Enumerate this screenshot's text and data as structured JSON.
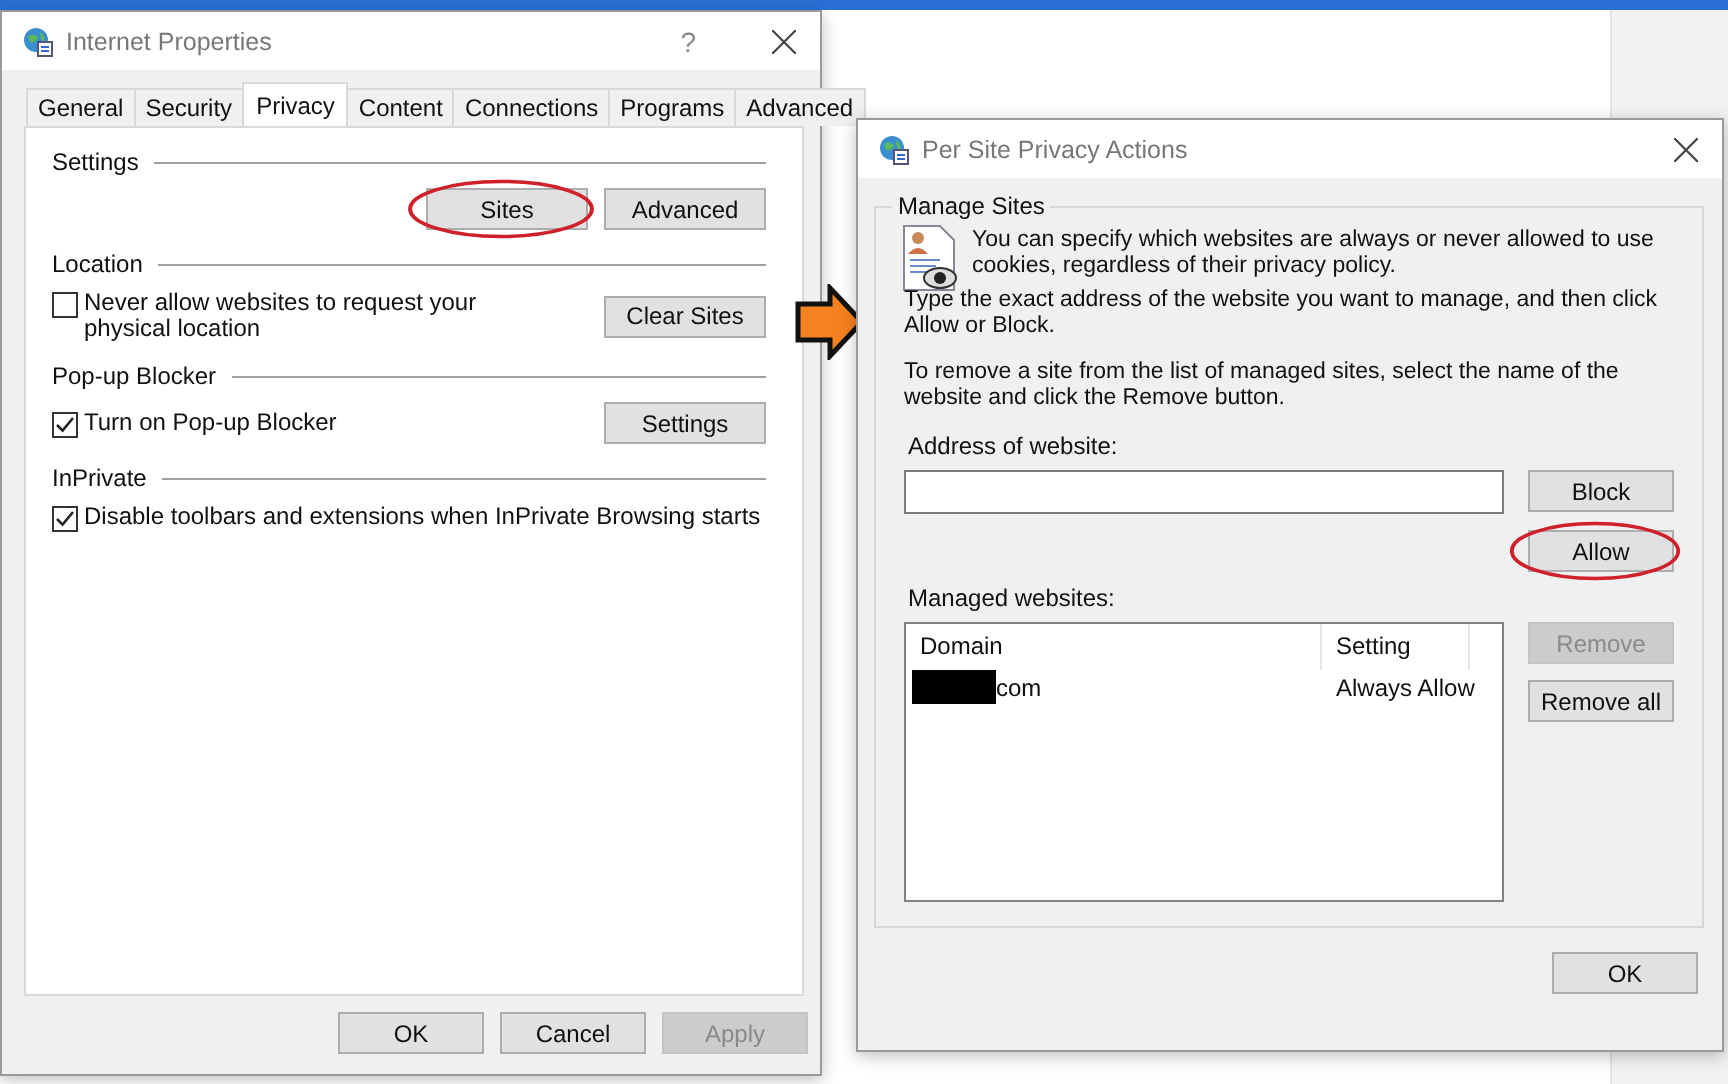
{
  "internet_properties": {
    "title": "Internet Properties",
    "help": "?",
    "tabs": [
      {
        "label": "General",
        "selected": false
      },
      {
        "label": "Security",
        "selected": false
      },
      {
        "label": "Privacy",
        "selected": true
      },
      {
        "label": "Content",
        "selected": false
      },
      {
        "label": "Connections",
        "selected": false
      },
      {
        "label": "Programs",
        "selected": false
      },
      {
        "label": "Advanced",
        "selected": false
      }
    ],
    "sections": [
      {
        "title": "Settings",
        "buttons": [
          {
            "label": "Sites",
            "highlighted": true
          },
          {
            "label": "Advanced",
            "highlighted": false
          }
        ]
      },
      {
        "title": "Location",
        "checkbox": {
          "label": "Never allow websites to request your physical location",
          "checked": false
        },
        "buttons": [
          {
            "label": "Clear Sites",
            "highlighted": false
          }
        ]
      },
      {
        "title": "Pop-up Blocker",
        "checkbox": {
          "label": "Turn on Pop-up Blocker",
          "checked": true
        },
        "buttons": [
          {
            "label": "Settings",
            "highlighted": false
          }
        ]
      },
      {
        "title": "InPrivate",
        "checkbox": {
          "label": "Disable toolbars and extensions when InPrivate Browsing starts",
          "checked": true
        }
      }
    ],
    "buttons": [
      {
        "label": "OK",
        "disabled": false
      },
      {
        "label": "Cancel",
        "disabled": false
      },
      {
        "label": "Apply",
        "disabled": true
      }
    ]
  },
  "per_site": {
    "title": "Per Site Privacy Actions",
    "group_title": "Manage Sites",
    "intro": "You can specify which websites are always or never allowed to use cookies, regardless of their privacy policy.",
    "instructions": [
      "Type the exact address of the website you want to manage, and then click Allow or Block.",
      "To remove a site from the list of managed sites, select the name of the website and click the Remove button."
    ],
    "address_label": "Address of website:",
    "action_buttons": [
      {
        "label": "Block",
        "highlighted": false
      },
      {
        "label": "Allow",
        "highlighted": true
      }
    ],
    "managed_label": "Managed websites:",
    "columns": [
      "Domain",
      "Setting"
    ],
    "rows": [
      {
        "domain": "com",
        "redacted": true,
        "setting": "Always Allow"
      }
    ],
    "side_buttons": [
      {
        "label": "Remove",
        "disabled": true
      },
      {
        "label": "Remove all",
        "disabled": false
      }
    ],
    "ok": "OK"
  }
}
